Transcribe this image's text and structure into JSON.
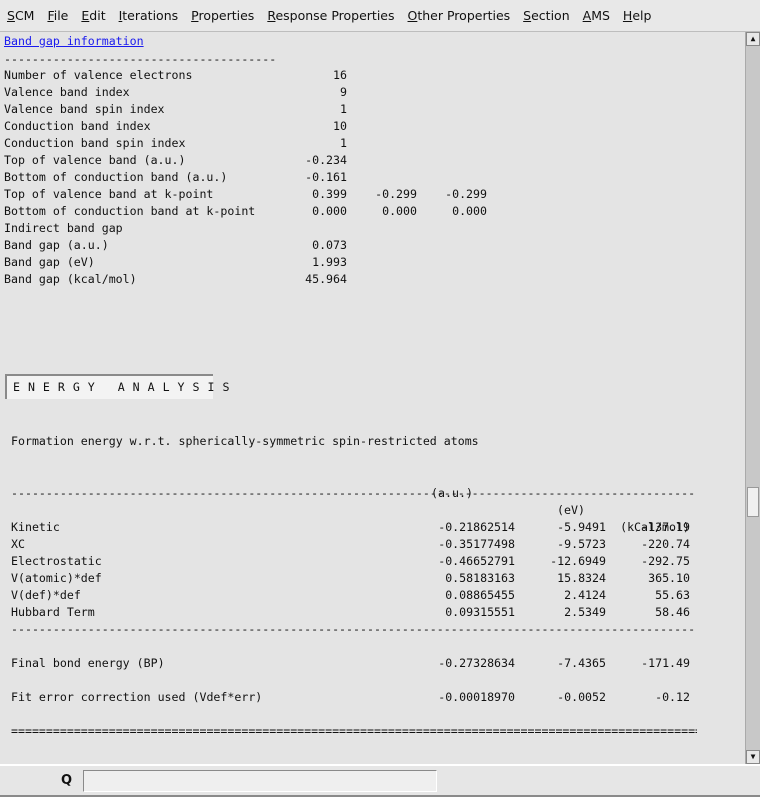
{
  "menu": [
    {
      "u": "S",
      "rest": "CM"
    },
    {
      "u": "F",
      "rest": "ile"
    },
    {
      "u": "E",
      "rest": "dit"
    },
    {
      "u": "I",
      "rest": "terations"
    },
    {
      "u": "P",
      "rest": "roperties"
    },
    {
      "u": "R",
      "rest": "esponse Properties"
    },
    {
      "u": "O",
      "rest": "ther Properties"
    },
    {
      "u": "S",
      "rest": "ection"
    },
    {
      "u": "A",
      "rest": "MS"
    },
    {
      "u": "H",
      "rest": "elp"
    }
  ],
  "bandgap": {
    "title": "Band gap information",
    "separator": "---------------------------------------",
    "rows": [
      {
        "label": "Number of valence electrons",
        "values": [
          "16"
        ]
      },
      {
        "label": "Valence band index",
        "values": [
          "9"
        ]
      },
      {
        "label": "Valence band spin index",
        "values": [
          "1"
        ]
      },
      {
        "label": "Conduction band index",
        "values": [
          "10"
        ]
      },
      {
        "label": "Conduction band spin index",
        "values": [
          "1"
        ]
      },
      {
        "label": "Top of valence band (a.u.)",
        "values": [
          "-0.234"
        ]
      },
      {
        "label": "Bottom of conduction band (a.u.)",
        "values": [
          "-0.161"
        ]
      },
      {
        "label": "Top of valence band at k-point",
        "values": [
          "0.399",
          "-0.299",
          "-0.299"
        ]
      },
      {
        "label": "Bottom of conduction band at k-point",
        "values": [
          "0.000",
          "0.000",
          "0.000"
        ]
      },
      {
        "label": "Indirect band gap",
        "values": []
      },
      {
        "label": "Band gap (a.u.)",
        "values": [
          "0.073"
        ]
      },
      {
        "label": "Band gap (eV)",
        "values": [
          "1.993"
        ]
      },
      {
        "label": "Band gap (kcal/mol)",
        "values": [
          "45.964"
        ]
      }
    ]
  },
  "energy": {
    "heading": "E N E R G Y   A N A L Y S I S",
    "subtitle": "Formation energy w.r.t. spherically-symmetric spin-restricted atoms",
    "columns": [
      "(a.u.)",
      "(eV)",
      "(kCal/mol)"
    ],
    "rows": [
      {
        "label": "Kinetic",
        "values": [
          "-0.21862514",
          "-5.9491",
          "-137.19"
        ]
      },
      {
        "label": "XC",
        "values": [
          "-0.35177498",
          "-9.5723",
          "-220.74"
        ]
      },
      {
        "label": "Electrostatic",
        "values": [
          "-0.46652791",
          "-12.6949",
          "-292.75"
        ]
      },
      {
        "label": "V(atomic)*def",
        "values": [
          "0.58183163",
          "15.8324",
          "365.10"
        ]
      },
      {
        "label": "V(def)*def",
        "values": [
          "0.08865455",
          "2.4124",
          "55.63"
        ]
      },
      {
        "label": "Hubbard Term",
        "values": [
          "0.09315551",
          "2.5349",
          "58.46"
        ]
      }
    ],
    "final": {
      "label": "Final bond energy (BP)",
      "values": [
        "-0.27328634",
        "-7.4365",
        "-171.49"
      ]
    },
    "fit": {
      "label": "Fit error correction used (Vdef*err)",
      "values": [
        "-0.00018970",
        "-0.0052",
        "-0.12"
      ]
    }
  },
  "search": {
    "value": "",
    "placeholder": ""
  },
  "icons": {
    "search": "magnifier-icon",
    "scroll_up": "arrow-up-icon",
    "scroll_down": "arrow-down-icon"
  },
  "colors": {
    "link": "#1a1aee",
    "background": "#e4e4e4"
  }
}
